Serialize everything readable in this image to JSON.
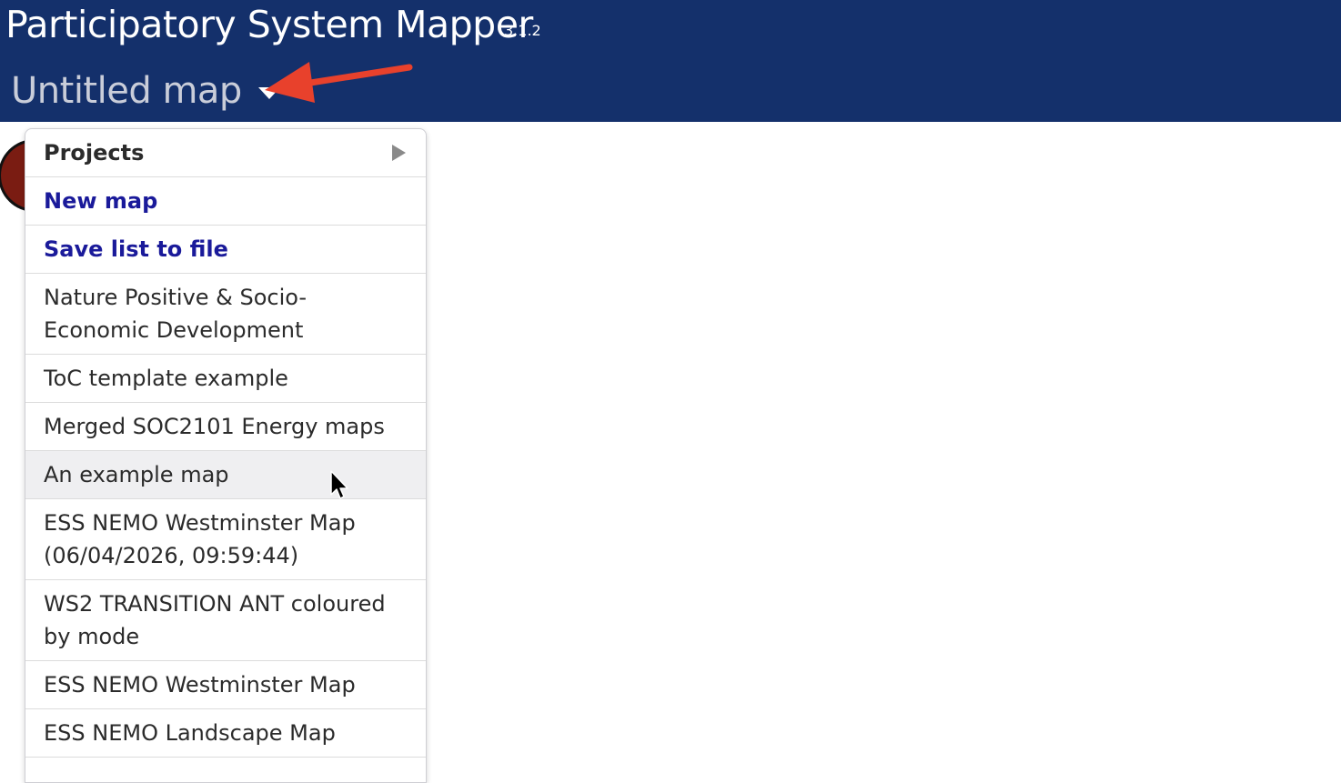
{
  "header": {
    "app_title": "Participatory System Mapper",
    "version": "3.1.2",
    "map_title": "Untitled map"
  },
  "menu": {
    "projects_label": "Projects",
    "new_map_label": "New map",
    "save_list_label": "Save list to file",
    "maps": [
      "Nature Positive & Socio-Economic Development",
      "ToC template example",
      "Merged SOC2101 Energy maps",
      "An example map",
      "ESS NEMO Westminster Map (06/04/2026, 09:59:44)",
      "WS2 TRANSITION ANT coloured by mode",
      "ESS NEMO Westminster Map",
      "ESS NEMO Landscape Map"
    ],
    "hovered_item": "An example map"
  },
  "colors": {
    "header_bg": "#14306b",
    "action_text": "#1a1a9a",
    "annotation_arrow": "#e8412c"
  },
  "icons": {
    "dropdown": "caret-down-icon",
    "submenu": "chevron-right-icon",
    "cursor": "mouse-pointer-icon",
    "annotation": "red-arrow-icon"
  }
}
